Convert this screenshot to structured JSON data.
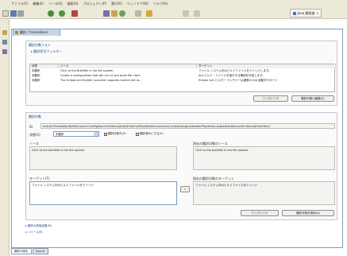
{
  "menubar": {
    "items": [
      "ファイル(F)",
      "編集(E)",
      "ソース(S)",
      "検索(A)",
      "プロジェクト(P)",
      "実行(R)",
      "ウィンドウ(W)",
      "ヘルプ(H)"
    ]
  },
  "toolbar": {
    "perspective_label": "Java 開発者",
    "perspective_suffix": "»"
  },
  "editor": {
    "tab_label": "翻訳 / translations",
    "section1": {
      "title": "翻訳対象リスト",
      "filter_label": "▸ 翻訳状況フィルター",
      "columns": [
        "状態",
        "ソース",
        "ターゲット"
      ],
      "rows": [
        {
          "state": "未翻訳",
          "source": "Click to the Buildfile in the file system.",
          "target": "ファイル システム内のビルドファイルをクリックします。"
        },
        {
          "state": "未翻訳",
          "source": "Create a configuration that will run an Ant build file. Here",
          "target": "Ant ビルド・ファイルを実行する構成を作成します。"
        },
        {
          "state": "未翻訳",
          "source": "The Eclipse Ant Builder Launcher supports normal Ant la...",
          "target": "Eclipse Ant ビルダー ランチャーは通常の Ant 起動をサポート"
        }
      ],
      "btn_next": "次の翻訳対象",
      "btn_edit": "翻訳対象の編集(E)"
    },
    "section2": {
      "title": "翻訳対象",
      "id_label": "ID",
      "id_value": "builder/TranslationBuilderLaunchConfig/launcherDescription/ExternalToolsBuilderLauncher/.eclipse/plugins/builderProperties.properties#launcher.description/Other",
      "state_label": "状態(S)",
      "state_value": "未翻訳",
      "checkbox1": "翻訳対象外(X)",
      "checkbox2": "翻訳済みにする(C)",
      "source_label": "ソース",
      "source_value": "Click to the buildfile in the file system.",
      "ref_source_label": "過去の翻訳対象のソース",
      "ref_source_value": "Click to the buildfile in the file system.",
      "target_label": "ターゲット(T)",
      "target_value": "ファイル システム内のビルドファイルをクリック",
      "ref_target_label": "過去の翻訳対象のターゲット",
      "ref_target_value": "ファイル システム内のビルドファイルをクリック",
      "copy_arrow": "«",
      "btn_prev": "前の翻訳対象",
      "btn_apply": "翻訳対象を適用(A)"
    },
    "collapsed1": "▸ 翻訳の検索結果(M)",
    "collapsed2": "▸ リソース(R)"
  },
  "bottom_tabs": [
    "翻訳の設定",
    "Source"
  ]
}
